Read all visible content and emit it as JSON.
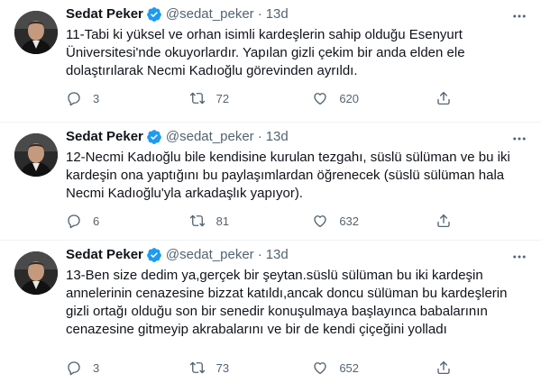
{
  "tweets": [
    {
      "name": "Sedat Peker",
      "handle": "@sedat_peker",
      "separator": "·",
      "time": "13d",
      "text": "11-Tabi ki yüksel ve orhan isimli kardeşlerin sahip olduğu Esenyurt Üniversitesi'nde okuyorlardır. Yapılan gizli çekim bir anda elden ele dolaştırılarak Necmi Kadıoğlu görevinden ayrıldı.",
      "replies": "3",
      "retweets": "72",
      "likes": "620"
    },
    {
      "name": "Sedat Peker",
      "handle": "@sedat_peker",
      "separator": "·",
      "time": "13d",
      "text": "12-Necmi Kadıoğlu bile kendisine kurulan tezgahı, süslü sülüman ve bu iki kardeşin ona yaptığını bu paylaşımlardan öğrenecek (süslü sülüman hala Necmi Kadıoğlu'yla arkadaşlık yapıyor).",
      "replies": "6",
      "retweets": "81",
      "likes": "632"
    },
    {
      "name": "Sedat Peker",
      "handle": "@sedat_peker",
      "separator": "·",
      "time": "13d",
      "text": "13-Ben size dedim ya,gerçek bir şeytan.süslü sülüman bu iki kardeşin annelerinin cenazesine bizzat katıldı,ancak doncu sülüman bu kardeşlerin gizli ortağı olduğu son bir senedir konuşulmaya başlayınca babalarının cenazesine gitmeyip akrabalarını ve bir de kendi çiçeğini yolladı",
      "replies": "3",
      "retweets": "73",
      "likes": "652"
    }
  ],
  "icons": {
    "avatar": "profile-photo",
    "verified": "verified-badge-icon",
    "more": "more-icon",
    "reply": "reply-icon",
    "retweet": "retweet-icon",
    "like": "like-icon",
    "share": "share-icon"
  },
  "colors": {
    "text": "#0f1419",
    "secondary": "#536471",
    "verified": "#1d9bf0",
    "divider": "#eff3f4"
  }
}
